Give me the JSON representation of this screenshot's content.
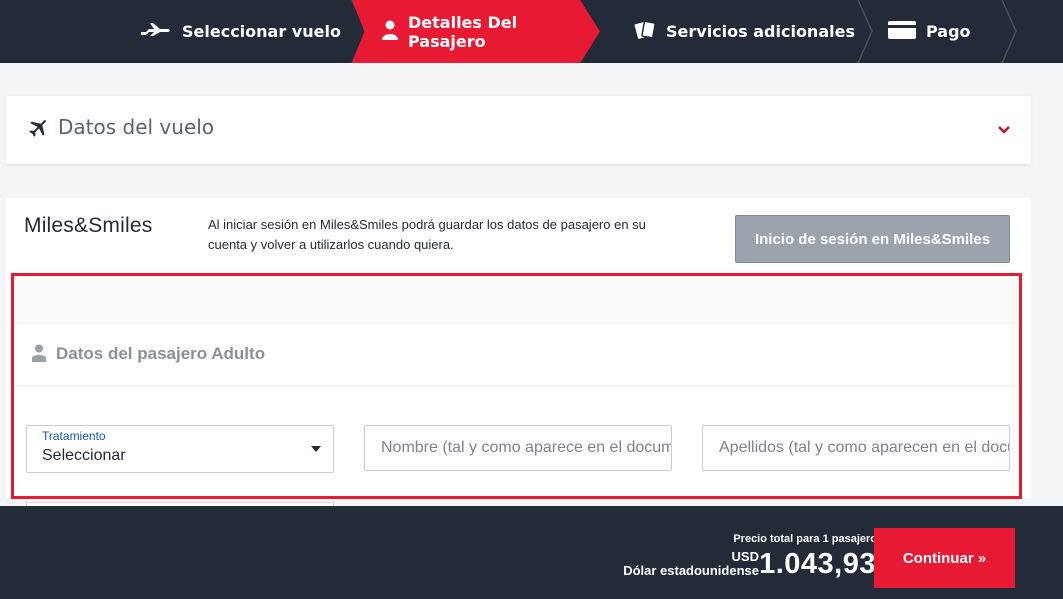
{
  "stepper": {
    "steps": [
      {
        "label": "Seleccionar vuelo",
        "icon": "plane-icon",
        "active": false
      },
      {
        "label": "Detalles Del Pasajero",
        "icon": "person-icon",
        "active": true
      },
      {
        "label": "Servicios adicionales",
        "icon": "ticket-icon",
        "active": false
      },
      {
        "label": "Pago",
        "icon": "card-icon",
        "active": false
      }
    ],
    "active_color": "#e81932",
    "bg_color": "#232b38"
  },
  "flight_card": {
    "title": "Datos del vuelo",
    "icon": "plane-icon",
    "toggle_icon": "chevron-down-icon"
  },
  "miles": {
    "logo": "Miles&Smiles",
    "description": "Al iniciar sesión en Miles&Smiles podrá guardar los datos de pasajero en su cuenta y volver a utilizarlos cuando quiera.",
    "login_button": "Inicio de sesión en Miles&Smiles"
  },
  "passenger": {
    "header": "Datos del pasajero Adulto",
    "icon": "person-icon",
    "title_field": {
      "label": "Tratamiento",
      "value": "Seleccionar"
    },
    "first_name_placeholder": "Nombre (tal y como aparece en el documento)",
    "last_name_placeholder": "Apellidos (tal y como aparecen en el documento)"
  },
  "footer": {
    "total_label": "Precio total para 1 pasajero",
    "currency_code": "USD",
    "currency_name": "Dólar estadounidense",
    "amount": "1.043,93",
    "continue_button": "Continuar »"
  },
  "highlight_color": "#e81932"
}
